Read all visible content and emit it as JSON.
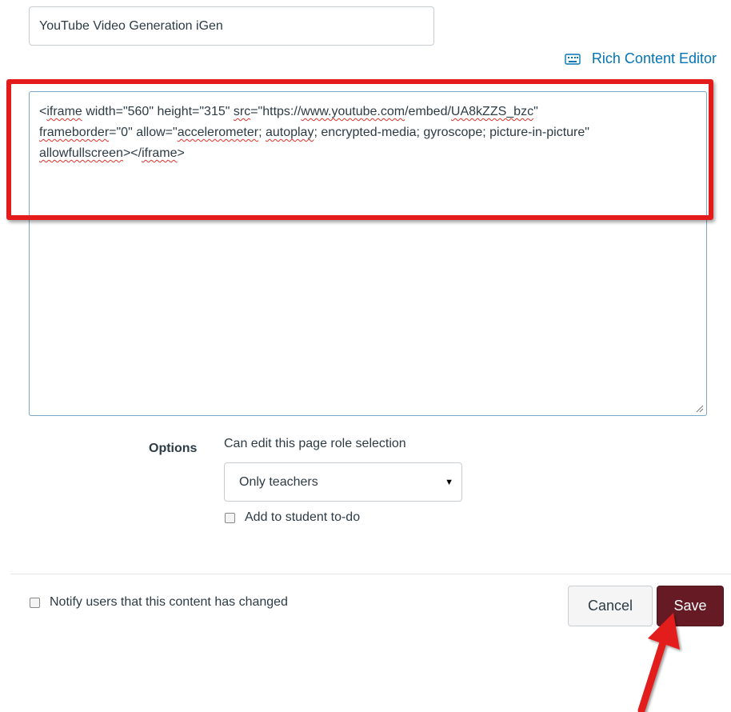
{
  "page": {
    "title_input_value": "YouTube Video Generation iGen",
    "rce_toggle_label": "Rich Content Editor"
  },
  "editor": {
    "lines": [
      "<iframe width=\"560\" height=\"315\" src=\"https://www.youtube.com/embed/UA8kZZS_bzc\"",
      "frameborder=\"0\" allow=\"accelerometer; autoplay; encrypted-media; gyroscope; picture-in-picture\"",
      "allowfullscreen></iframe>"
    ],
    "seg": {
      "l1a": "<",
      "l1b": "iframe",
      "l1c": " width=\"560\" height=\"315\" ",
      "l1d": "src",
      "l1e": "=\"",
      "l1f": "https",
      "l1g": "://",
      "l1h": "www.youtube.com",
      "l1i": "/embed/",
      "l1j": "UA8kZZS_bzc",
      "l1k": "\"",
      "l2a": "frameborder",
      "l2b": "=\"0\" allow=\"",
      "l2c": "accelerometer",
      "l2d": "; ",
      "l2e": "autoplay",
      "l2f": "; encrypted-media; gyroscope; picture-in-picture\"",
      "l3a": "allowfullscreen",
      "l3b": "></",
      "l3c": "iframe",
      "l3d": ">"
    }
  },
  "options": {
    "label": "Options",
    "role_label": "Can edit this page role selection",
    "role_selected": "Only teachers",
    "todo_label": "Add to student to-do",
    "todo_checked": false
  },
  "footer": {
    "notify_label": "Notify users that this content has changed",
    "notify_checked": false,
    "cancel_label": "Cancel",
    "save_label": "Save"
  },
  "colors": {
    "accent": "#0374b5",
    "save_button": "#661b24",
    "highlight": "#e31b1b"
  },
  "icons": {
    "rce_toggle": "keyboard-icon",
    "select_caret": "caret-down-icon",
    "resize": "resize-handle-icon",
    "annotation": "red-arrow-icon"
  }
}
